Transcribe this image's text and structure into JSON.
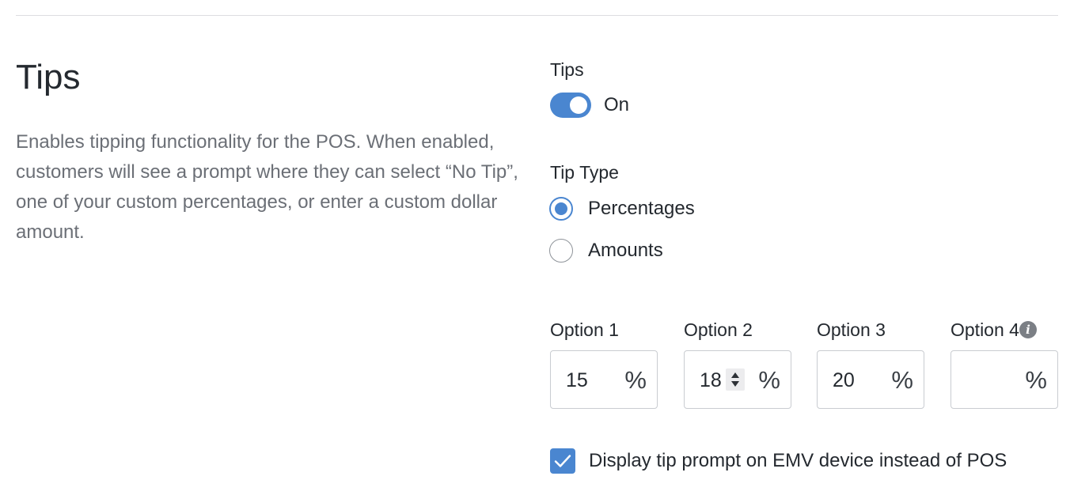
{
  "section": {
    "title": "Tips",
    "description": "Enables tipping functionality for the POS. When enabled, customers will see a prompt where they can select “No Tip”, one of your custom percentages, or enter a custom dollar amount."
  },
  "tips_toggle": {
    "label": "Tips",
    "state_text": "On",
    "enabled": true,
    "accent_color": "#4a86d0"
  },
  "tip_type": {
    "label": "Tip Type",
    "options": [
      {
        "label": "Percentages",
        "selected": true
      },
      {
        "label": "Amounts",
        "selected": false
      }
    ]
  },
  "tip_options": [
    {
      "label": "Option 1",
      "value": "15",
      "suffix": "%"
    },
    {
      "label": "Option 2",
      "value": "18",
      "suffix": "%",
      "stepper_visible": true
    },
    {
      "label": "Option 3",
      "value": "20",
      "suffix": "%"
    },
    {
      "label": "Option 4",
      "value": "",
      "suffix": "%",
      "info_icon": "info-icon",
      "info_glyph": "i"
    }
  ],
  "emv_prompt": {
    "label": "Display tip prompt on EMV device instead of POS",
    "checked": true
  }
}
